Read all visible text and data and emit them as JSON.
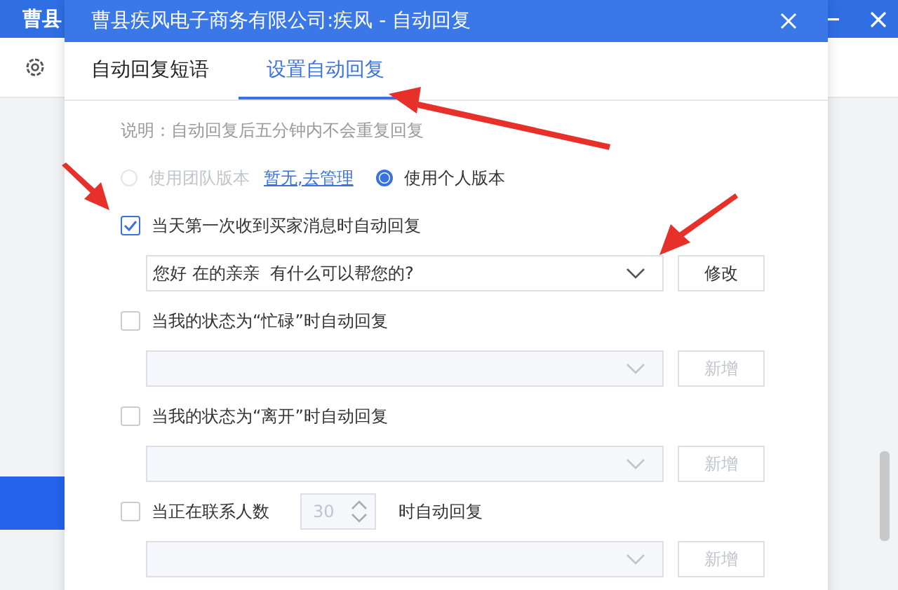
{
  "background_window": {
    "title": "曹县"
  },
  "dialog": {
    "title": "曹县疾风电子商务有限公司:疾风 - 自动回复"
  },
  "tabs": [
    {
      "label": "自动回复短语",
      "selected": false
    },
    {
      "label": "设置自动回复",
      "selected": true
    }
  ],
  "note": "说明：自动回复后五分钟内不会重复回复",
  "version": {
    "options": [
      {
        "label": "使用团队版本",
        "selected": false,
        "disabled": true
      },
      {
        "label": "使用个人版本",
        "selected": true,
        "disabled": false
      }
    ],
    "link": "暂无,去管理"
  },
  "rules": [
    {
      "kind": "simple",
      "label": "当天第一次收到买家消息时自动回复",
      "checked": true,
      "reply": {
        "value": "您好 在的亲亲  有什么可以帮您的?",
        "disabled": false
      },
      "button": {
        "label": "修改",
        "disabled": false
      }
    },
    {
      "kind": "simple",
      "label": "当我的状态为“忙碌”时自动回复",
      "checked": false,
      "reply": {
        "disabled": true
      },
      "button": {
        "label": "新增",
        "disabled": true
      }
    },
    {
      "kind": "simple",
      "label": "当我的状态为“离开”时自动回复",
      "checked": false,
      "reply": {
        "disabled": true
      },
      "button": {
        "label": "新增",
        "disabled": true
      }
    },
    {
      "kind": "count",
      "label": "当正在联系人数",
      "count": "30",
      "suffix": "时自动回复",
      "checked": false,
      "reply": {
        "disabled": true
      },
      "button": {
        "label": "新增",
        "disabled": true
      }
    }
  ]
}
